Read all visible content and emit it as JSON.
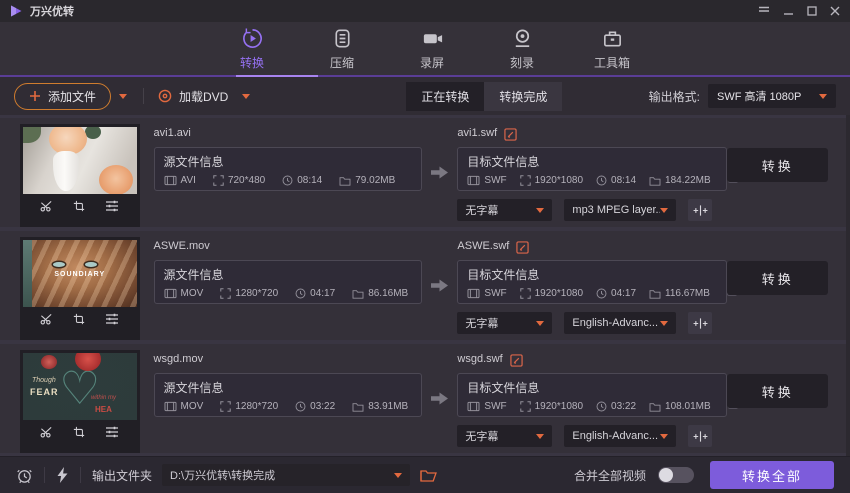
{
  "window": {
    "title": "万兴优转"
  },
  "nav": {
    "tabs": [
      {
        "label": "转换",
        "active": true
      },
      {
        "label": "压缩",
        "active": false
      },
      {
        "label": "录屏",
        "active": false
      },
      {
        "label": "刻录",
        "active": false
      },
      {
        "label": "工具箱",
        "active": false
      }
    ]
  },
  "toolbar": {
    "add_files": "添加文件",
    "load_dvd": "加载DVD",
    "tab_converting": "正在转换",
    "tab_done": "转换完成",
    "output_format_label": "输出格式:",
    "output_format_value": "SWF 高清 1080P"
  },
  "rows": [
    {
      "source_filename": "avi1.avi",
      "source": {
        "panel_title": "源文件信息",
        "format": "AVI",
        "resolution": "720*480",
        "duration": "08:14",
        "size": "79.02MB"
      },
      "target_filename": "avi1.swf",
      "target": {
        "panel_title": "目标文件信息",
        "format": "SWF",
        "resolution": "1920*1080",
        "duration": "08:14",
        "size": "184.22MB"
      },
      "subtitle": "无字幕",
      "audio": "mp3 MPEG layer...",
      "convert_label": "转换"
    },
    {
      "source_filename": "ASWE.mov",
      "source": {
        "panel_title": "源文件信息",
        "format": "MOV",
        "resolution": "1280*720",
        "duration": "04:17",
        "size": "86.16MB"
      },
      "target_filename": "ASWE.swf",
      "target": {
        "panel_title": "目标文件信息",
        "format": "SWF",
        "resolution": "1920*1080",
        "duration": "04:17",
        "size": "116.67MB"
      },
      "subtitle": "无字幕",
      "audio": "English-Advanc...",
      "convert_label": "转换",
      "thumb_text": "SOUNDIARY"
    },
    {
      "source_filename": "wsgd.mov",
      "source": {
        "panel_title": "源文件信息",
        "format": "MOV",
        "resolution": "1280*720",
        "duration": "03:22",
        "size": "83.91MB"
      },
      "target_filename": "wsgd.swf",
      "target": {
        "panel_title": "目标文件信息",
        "format": "SWF",
        "resolution": "1920*1080",
        "duration": "03:22",
        "size": "108.01MB"
      },
      "subtitle": "无字幕",
      "audio": "English-Advanc...",
      "convert_label": "转换",
      "thumb": {
        "word1": "Though",
        "word2": "FEAR",
        "word3": "within my",
        "word4": "HEA",
        "heart": "♡"
      }
    }
  ],
  "bottombar": {
    "output_folder_label": "输出文件夹",
    "output_path": "D:\\万兴优转\\转换完成",
    "merge_label": "合并全部视频",
    "convert_all": "转换全部"
  },
  "colors": {
    "accent_purple": "#7d5cdb",
    "accent_orange": "#e2693f"
  }
}
